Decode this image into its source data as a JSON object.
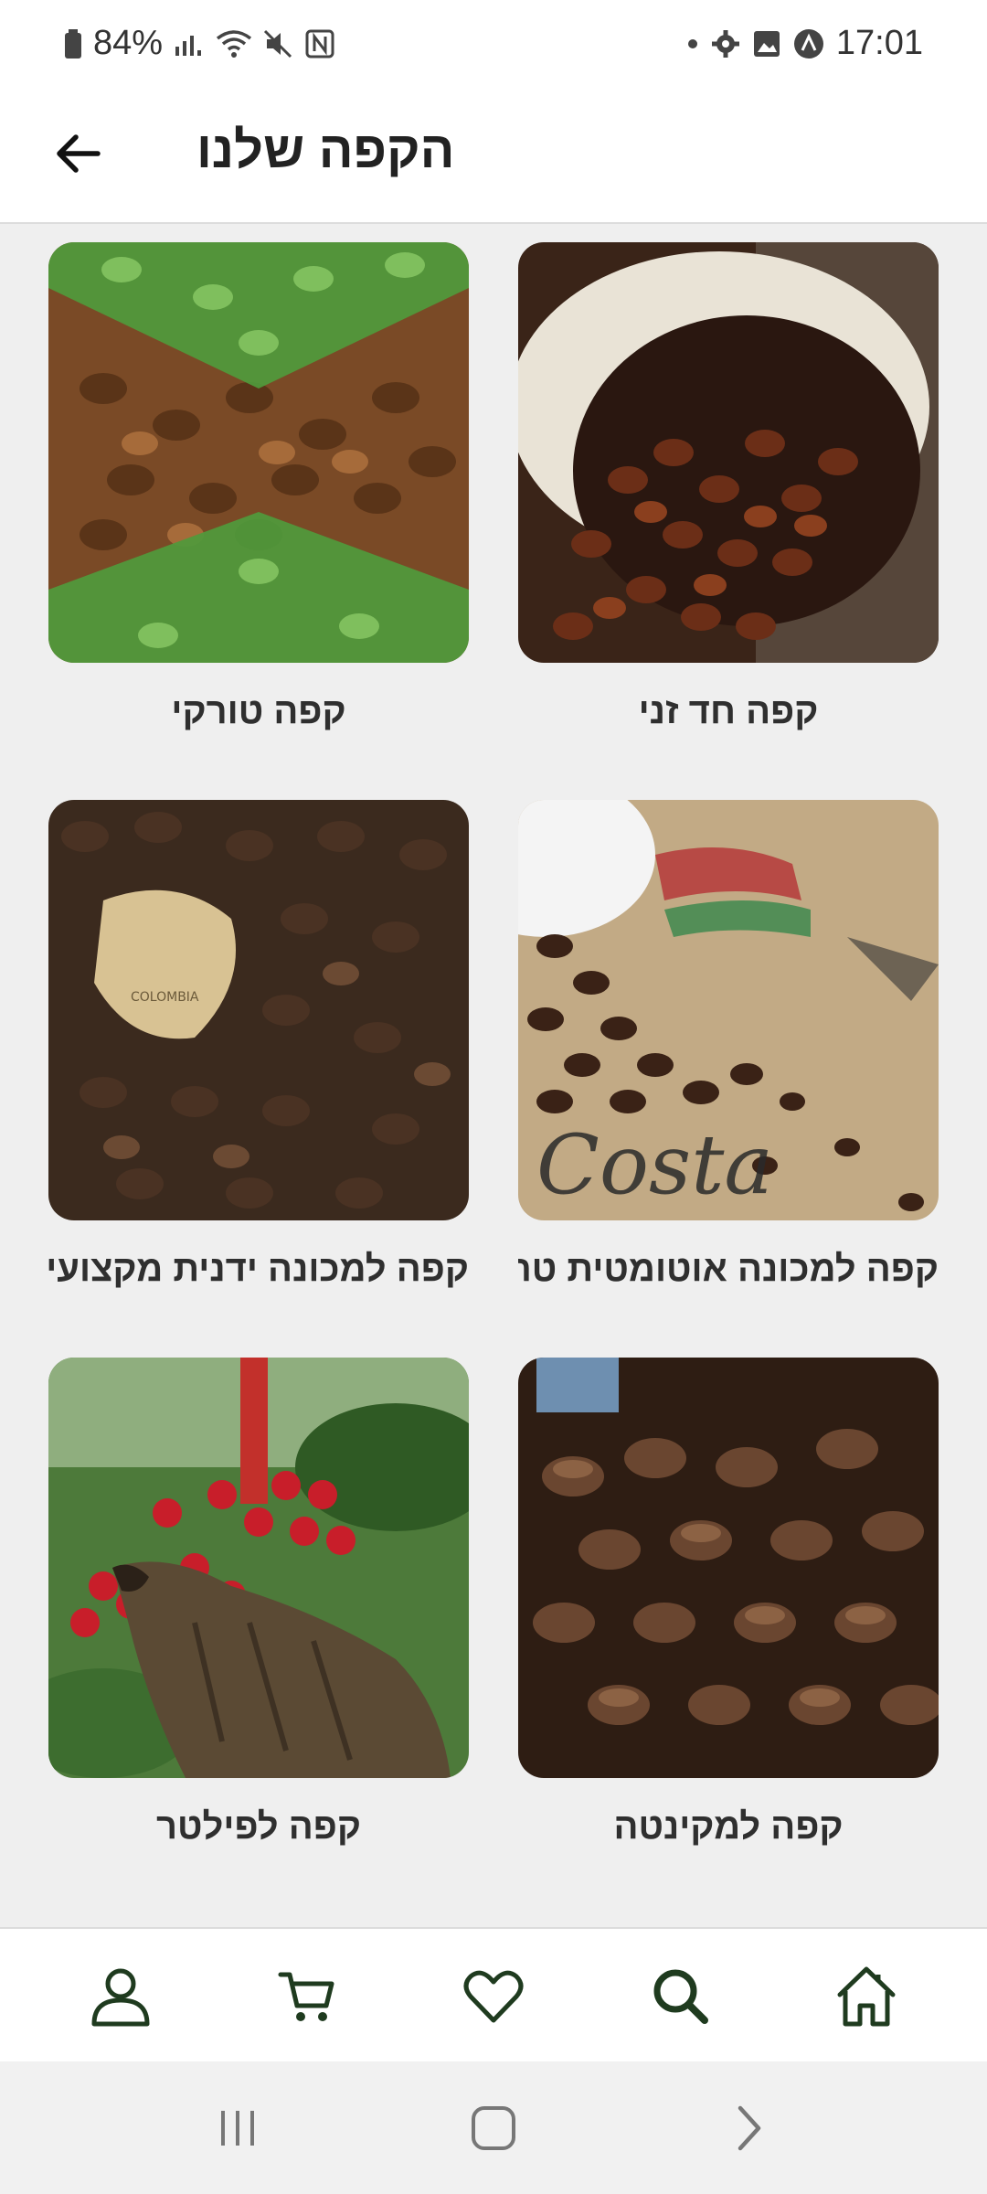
{
  "status_bar": {
    "battery": "84%",
    "time": "17:01"
  },
  "header": {
    "title": "הקפה שלנו",
    "back_icon": "arrow-left-icon"
  },
  "categories": [
    {
      "label": "קפה חד זני",
      "image": "beans-in-white-cup"
    },
    {
      "label": "קפה טורקי",
      "image": "green-and-roasted-beans"
    },
    {
      "label": "קפה למכונה אוטומטית טרייה",
      "image": "beans-spilling-on-burlap-sack"
    },
    {
      "label": "קפה למכונה ידנית מקצועית",
      "image": "beans-on-colombia-map"
    },
    {
      "label": "קפה למקינטה",
      "image": "roasted-beans-closeup"
    },
    {
      "label": "קפה לפילטר",
      "image": "civet-with-coffee-cherries"
    }
  ],
  "bottom_nav": [
    {
      "name": "profile",
      "icon": "user-icon"
    },
    {
      "name": "cart",
      "icon": "cart-icon"
    },
    {
      "name": "favorites",
      "icon": "heart-icon"
    },
    {
      "name": "search",
      "icon": "search-icon"
    },
    {
      "name": "home",
      "icon": "home-icon"
    }
  ],
  "colors": {
    "brand_dark_green": "#1f3b1f",
    "background": "#efefef"
  }
}
